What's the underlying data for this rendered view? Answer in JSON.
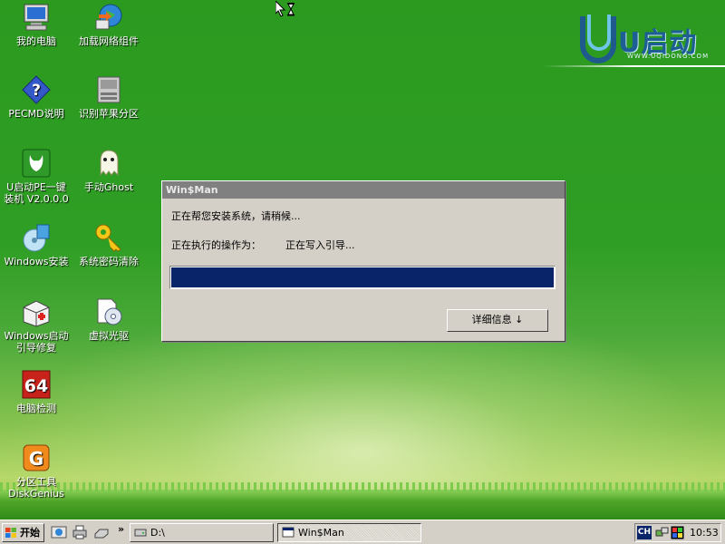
{
  "desktop": {
    "icons": [
      {
        "label": "我的电脑",
        "icon": "my-computer-icon"
      },
      {
        "label": "加载网络组件",
        "icon": "network-globe-icon"
      },
      {
        "label": "PECMD说明",
        "icon": "help-icon"
      },
      {
        "label": "识别苹果分区",
        "icon": "disk-drive-icon"
      },
      {
        "label": "U启动PE一键装机 V2.0.0.0",
        "icon": "installer-icon"
      },
      {
        "label": "手动Ghost",
        "icon": "ghost-icon"
      },
      {
        "label": "Windows安装",
        "icon": "windows-setup-icon"
      },
      {
        "label": "系统密码清除",
        "icon": "key-icon"
      },
      {
        "label": "Windows启动引导修复",
        "icon": "boot-repair-icon"
      },
      {
        "label": "虚拟光驱",
        "icon": "virtual-cd-icon"
      },
      {
        "label": "电脑检测",
        "icon": "64-test-icon"
      },
      {
        "label": "分区工具DiskGenius",
        "icon": "diskgenius-icon"
      }
    ]
  },
  "logo": {
    "brand": "U启动",
    "url": "WWW.UQIDONG.COM"
  },
  "dialog": {
    "title": "Win$Man",
    "message": "正在帮您安装系统，请稍候...",
    "operation_label": "正在执行的操作为：",
    "operation_value": "正在写入引导...",
    "progress": 1.0,
    "details_button": "详细信息 ↓"
  },
  "taskbar": {
    "start_label": "开始",
    "chevron": "»",
    "tasks": [
      {
        "label": "D:\\",
        "active": false
      },
      {
        "label": "Win$Man",
        "active": true
      }
    ],
    "tray": {
      "ime": "CH",
      "clock": "10:53"
    }
  },
  "colors": {
    "desktop": "#2f9e24",
    "progress": "#0a246a",
    "dialog_bg": "#d4d0c8"
  }
}
